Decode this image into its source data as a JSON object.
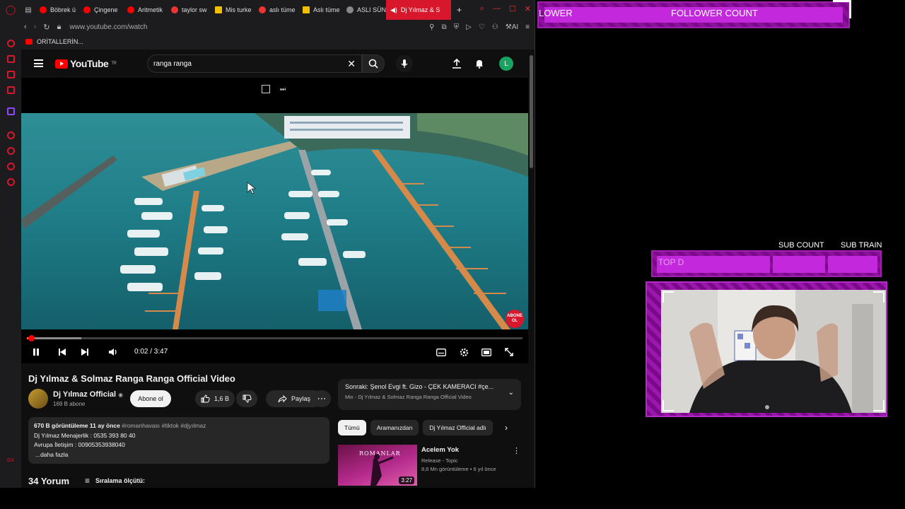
{
  "browser": {
    "tabs": [
      {
        "label": "Böbrek ü",
        "icon": "youtube-icon"
      },
      {
        "label": "Çingene",
        "icon": "youtube-icon"
      },
      {
        "label": "Aritmetik",
        "icon": "youtube-icon"
      },
      {
        "label": "taylor sw",
        "icon": "yandex-icon"
      },
      {
        "label": "Mis turke",
        "icon": "folder-icon"
      },
      {
        "label": "aslı tüme",
        "icon": "yandex-icon"
      },
      {
        "label": "Aslı tüme",
        "icon": "folder-icon"
      },
      {
        "label": "ASLI SÜN",
        "icon": "globe-icon"
      },
      {
        "label": "Dj Yılmaz & S",
        "icon": "speaker-icon"
      }
    ],
    "new_tab": "+",
    "url": "www.youtube.com/watch",
    "ai_label": "AI",
    "bookmark": "ORİTALLERİN..."
  },
  "youtube": {
    "logo_text": "YouTube",
    "logo_region": "TR",
    "search_value": "ranga ranga",
    "avatar_letter": "L",
    "player": {
      "time": "0:02 / 3:47",
      "progress_fraction": 0.009,
      "watermark": "ABONE OL"
    },
    "video_title": "Dj Yılmaz & Solmaz Ranga Ranga Official Video",
    "channel": {
      "name": "Dj Yılmaz Official",
      "subs": "169 B abone",
      "subscribe_label": "Abone ol"
    },
    "likes": "1,6 B",
    "share_label": "Paylaş",
    "description": {
      "stats": "670 B görüntüleme  11 ay önce",
      "tags": "#romanhavası #tiktok #djyılmaz",
      "line2": "Dj Yılmaz Menajerlik : 0535 393 80 40",
      "line3": "Avrupa İletişim : 00905353938040",
      "more": "...daha fazla"
    },
    "comments_count": "34 Yorum",
    "sort_label": "Sıralama ölçütü:",
    "next_up": {
      "title": "Sonraki: Şenol Evgi ft. Gizo - ÇEK KAMERACI #çe...",
      "subtitle": "Mix - Dj Yılmaz & Solmaz Ranga Ranga Official Video"
    },
    "chips": [
      "Tümü",
      "Aramanızdan",
      "Dj Yılmaz Official adlı"
    ],
    "recommendation": {
      "thumb_word": "ROMANLAR",
      "duration": "3:27",
      "title": "Acelem Yok",
      "channel": "Release - Topic",
      "meta": "8,6 Mn görüntüleme • 6 yıl önce"
    }
  },
  "overlay": {
    "follower_left": "LOWER",
    "follower_count": "FOLLOWER COUNT",
    "sub_count": "SUB COUNT",
    "sub_train": "SUB TRAIN",
    "top_label": "TOP D",
    "accent": "#c428dc"
  }
}
